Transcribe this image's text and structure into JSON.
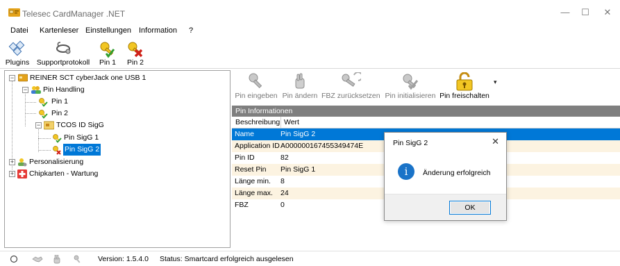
{
  "window": {
    "title": "Telesec CardManager .NET",
    "minimize": "—",
    "maximize": "☐",
    "close": "✕"
  },
  "menu": {
    "items": [
      "Datei",
      "Kartenleser",
      "Einstellungen",
      "Information",
      "?"
    ]
  },
  "toolbar": {
    "plugins": "Plugins",
    "supportprotokoll": "Supportprotokoll",
    "pin1": "Pin 1",
    "pin2": "Pin 2"
  },
  "tree": {
    "reader": "REINER SCT cyberJack one USB 1",
    "pin_handling": "Pin Handling",
    "pin1": "Pin 1",
    "pin2": "Pin 2",
    "tcos": "TCOS ID SigG",
    "pin_sigg1": "Pin SigG 1",
    "pin_sigg2": "Pin SigG 2",
    "personalisierung": "Personalisierung",
    "chipkarten": "Chipkarten - Wartung",
    "expand_minus": "−",
    "expand_plus": "+"
  },
  "actions": {
    "pin_eingeben": "Pin eingeben",
    "pin_aendern": "Pin ändern",
    "fbz_zuruecksetzen": "FBZ zurücksetzen",
    "pin_initialisieren": "Pin initialisieren",
    "pin_freischalten": "Pin freischalten",
    "dropdown": "▾"
  },
  "info": {
    "header": "Pin Informationen",
    "col_beschreibung": "Beschreibung",
    "col_wert": "Wert",
    "rows": [
      {
        "key": "Name",
        "value": "Pin SigG 2"
      },
      {
        "key": "Application ID",
        "value": "A000000167455349474E"
      },
      {
        "key": "Pin ID",
        "value": "82"
      },
      {
        "key": "Reset Pin",
        "value": "Pin SigG 1"
      },
      {
        "key": "Länge min.",
        "value": "8"
      },
      {
        "key": "Länge max.",
        "value": "24"
      },
      {
        "key": "FBZ",
        "value": "0"
      }
    ]
  },
  "dialog": {
    "title": "Pin SigG 2",
    "close": "✕",
    "info_glyph": "i",
    "message": "Änderung erfolgreich",
    "ok": "OK"
  },
  "status": {
    "version": "Version: 1.5.4.0",
    "status": "Status: Smartcard erfolgreich ausgelesen"
  },
  "colors": {
    "selection": "#0078d7",
    "alt_row": "#fcf3e1",
    "header_bg": "#7f7f7f"
  }
}
